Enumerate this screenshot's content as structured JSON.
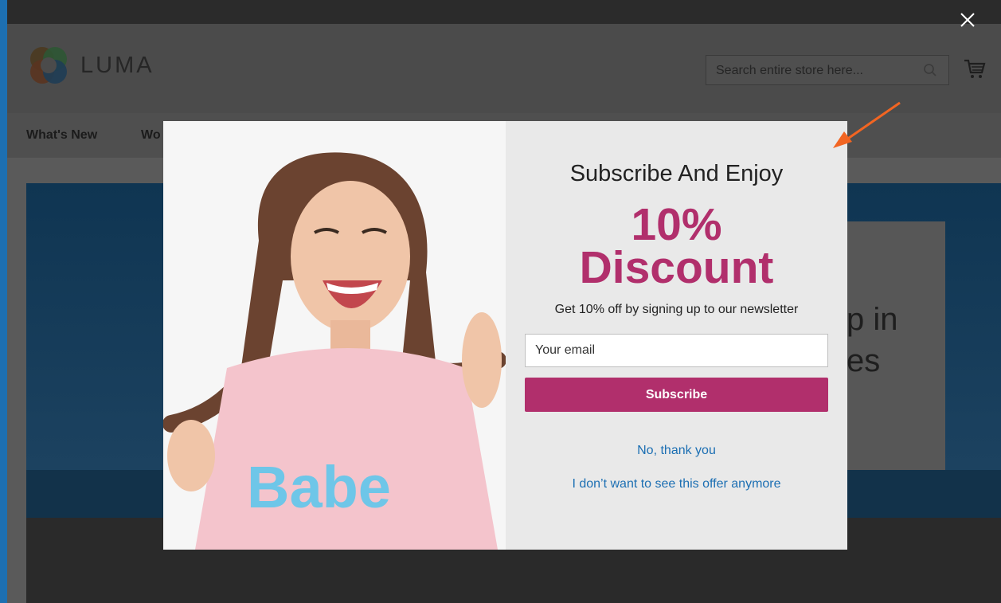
{
  "header": {
    "logo_text": "LUMA",
    "search_placeholder": "Search entire store here..."
  },
  "nav": {
    "items": [
      "What's New",
      "Wo"
    ]
  },
  "hero": {
    "text_line_1": "p in",
    "text_line_2": "es"
  },
  "modal": {
    "heading": "Subscribe And Enjoy",
    "discount_percent": "10%",
    "discount_word": "Discount",
    "description": "Get 10% off by signing up to our newsletter",
    "email_placeholder": "Your email",
    "subscribe_label": "Subscribe",
    "no_thanks": "No, thank you",
    "dont_show": "I don’t want to see this offer anymore",
    "image_shirt_text": "Babe"
  },
  "colors": {
    "accent": "#b12f6c",
    "link": "#1c6fb3",
    "arrow": "#f26522",
    "frame_border": "#1d6fb1"
  },
  "icons": [
    "close-icon",
    "search-icon",
    "cart-icon",
    "arrow-annotation-icon",
    "logo-icon"
  ]
}
